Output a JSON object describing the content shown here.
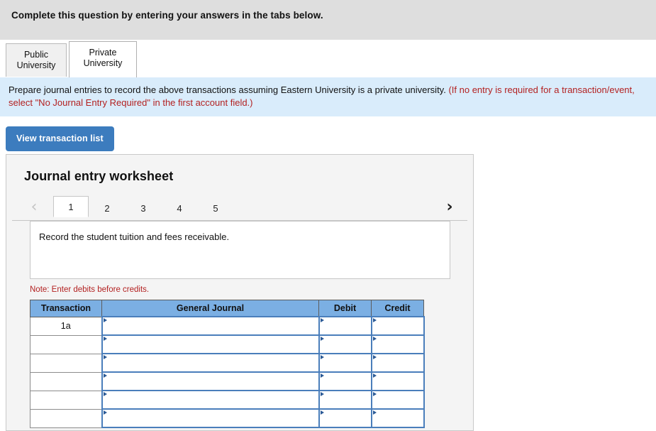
{
  "banner": {
    "text": "Complete this question by entering your answers in the tabs below."
  },
  "university_tabs": [
    {
      "line1": "Public",
      "line2": "University",
      "active": false
    },
    {
      "line1": "Private",
      "line2": "University",
      "active": true
    }
  ],
  "instruction": {
    "black_text": "Prepare journal entries to record the above transactions assuming Eastern University is a private university. ",
    "red_text": "(If no entry is required for a transaction/event, select \"No Journal Entry Required\" in the first account field.)"
  },
  "toolbar": {
    "view_transaction_list_label": "View transaction list"
  },
  "worksheet": {
    "title": "Journal entry worksheet",
    "nav": {
      "prev_icon": "chevron-left-icon",
      "next_icon": "chevron-right-icon",
      "prev_enabled": false,
      "next_enabled": true
    },
    "entry_tabs": [
      {
        "label": "1",
        "active": true
      },
      {
        "label": "2",
        "active": false
      },
      {
        "label": "3",
        "active": false
      },
      {
        "label": "4",
        "active": false
      },
      {
        "label": "5",
        "active": false
      }
    ],
    "description": "Record the student tuition and fees receivable.",
    "note": "Note: Enter debits before credits.",
    "table": {
      "headers": [
        "Transaction",
        "General Journal",
        "Debit",
        "Credit"
      ],
      "rows": [
        {
          "transaction": "1a",
          "general_journal": "",
          "debit": "",
          "credit": ""
        },
        {
          "transaction": "",
          "general_journal": "",
          "debit": "",
          "credit": ""
        },
        {
          "transaction": "",
          "general_journal": "",
          "debit": "",
          "credit": ""
        },
        {
          "transaction": "",
          "general_journal": "",
          "debit": "",
          "credit": ""
        },
        {
          "transaction": "",
          "general_journal": "",
          "debit": "",
          "credit": ""
        },
        {
          "transaction": "",
          "general_journal": "",
          "debit": "",
          "credit": ""
        }
      ]
    }
  },
  "colors": {
    "banner_gray": "#dedede",
    "instruction_blue": "#d9ecfb",
    "button_blue": "#3c7cbe",
    "table_header_blue": "#7bafe3",
    "input_border_blue": "#4a7ebb",
    "red_text": "#b32121"
  }
}
